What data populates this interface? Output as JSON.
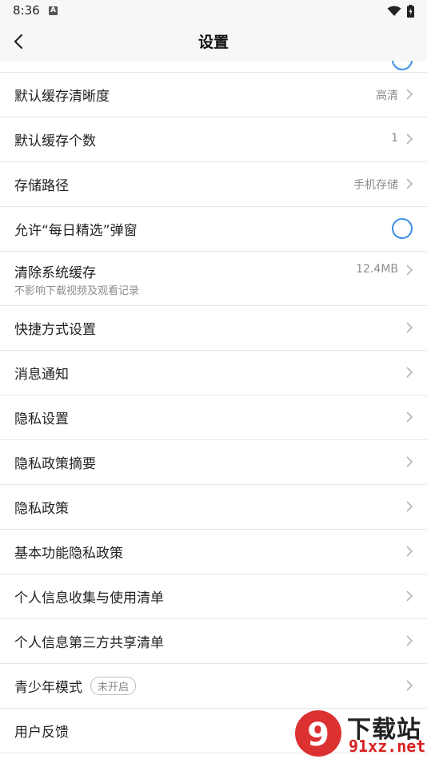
{
  "status_bar": {
    "time": "8:36",
    "notification_letter": "A"
  },
  "header": {
    "title": "设置"
  },
  "rows": [
    {
      "label": "默认缓存清晰度",
      "value": "高清"
    },
    {
      "label": "默认缓存个数",
      "value": "1"
    },
    {
      "label": "存储路径",
      "value": "手机存储"
    },
    {
      "label": "允许“每日精选”弹窗",
      "toggle_on": false
    },
    {
      "label": "清除系统缓存",
      "value": "12.4MB",
      "sub": "不影响下载视频及观看记录"
    },
    {
      "label": "快捷方式设置"
    },
    {
      "label": "消息通知"
    },
    {
      "label": "隐私设置"
    },
    {
      "label": "隐私政策摘要"
    },
    {
      "label": "隐私政策"
    },
    {
      "label": "基本功能隐私政策"
    },
    {
      "label": "个人信息收集与使用清单"
    },
    {
      "label": "个人信息第三方共享清单"
    },
    {
      "label": "青少年模式",
      "badge": "未开启"
    },
    {
      "label": "用户反馈"
    }
  ],
  "watermark": {
    "brand": "下载站",
    "domain": "91xz.net",
    "logo_mark": "9"
  },
  "colors": {
    "accent": "#3a8ee6",
    "divider": "#e6e6e6",
    "watermark_red": "#d82020"
  }
}
